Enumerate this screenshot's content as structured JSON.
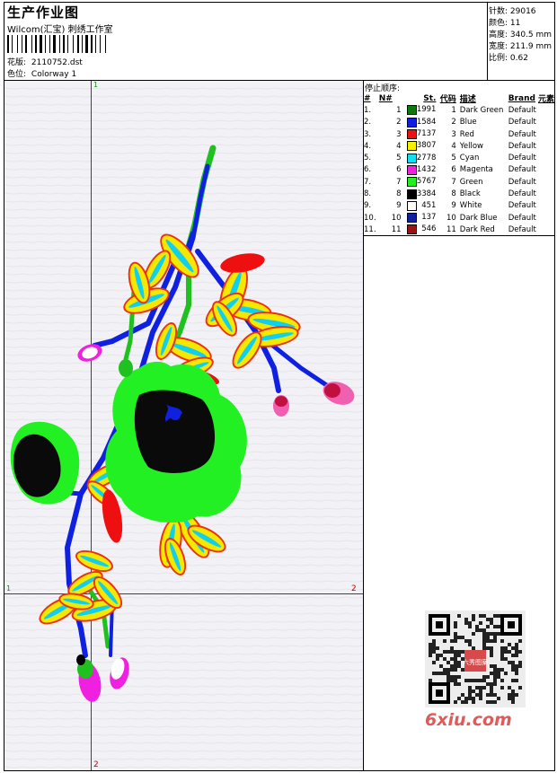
{
  "header": {
    "title": "生产作业图",
    "subtitle": "Wilcom(汇宝) 刺绣工作室",
    "design_label": "花版:",
    "design_value": "2110752.dst",
    "colorway_label": "色位:",
    "colorway_value": "Colorway 1"
  },
  "stats": {
    "stitches": "针数: 29016",
    "colors": "颜色: 11",
    "height": "高度: 340.5 mm",
    "width": "宽度: 211.9 mm",
    "scale": "比例: 0.62"
  },
  "guides": {
    "top_v": "1",
    "bottom_v": "2",
    "left_h": "1",
    "right_h": "2"
  },
  "stop_sequence": {
    "title": "停止顺序:",
    "headers": [
      "#",
      "N#",
      "St.",
      "代码",
      "描述",
      "Brand",
      "元素"
    ],
    "rows": [
      {
        "idx": "1.",
        "n": "1",
        "color": "#0a7a0a",
        "st": "1991",
        "code": "1",
        "desc": "Dark Green",
        "brand": "Default"
      },
      {
        "idx": "2.",
        "n": "2",
        "color": "#1020e0",
        "st": "1584",
        "code": "2",
        "desc": "Blue",
        "brand": "Default"
      },
      {
        "idx": "3.",
        "n": "3",
        "color": "#ee1010",
        "st": "7137",
        "code": "3",
        "desc": "Red",
        "brand": "Default"
      },
      {
        "idx": "4.",
        "n": "4",
        "color": "#f5f000",
        "st": "3807",
        "code": "4",
        "desc": "Yellow",
        "brand": "Default"
      },
      {
        "idx": "5.",
        "n": "5",
        "color": "#10e0f0",
        "st": "2778",
        "code": "5",
        "desc": "Cyan",
        "brand": "Default"
      },
      {
        "idx": "6.",
        "n": "6",
        "color": "#f020e0",
        "st": "1432",
        "code": "6",
        "desc": "Magenta",
        "brand": "Default"
      },
      {
        "idx": "7.",
        "n": "7",
        "color": "#20f020",
        "st": "5767",
        "code": "7",
        "desc": "Green",
        "brand": "Default"
      },
      {
        "idx": "8.",
        "n": "8",
        "color": "#000000",
        "st": "3384",
        "code": "8",
        "desc": "Black",
        "brand": "Default"
      },
      {
        "idx": "9.",
        "n": "9",
        "color": "#ffffff",
        "st": "451",
        "code": "9",
        "desc": "White",
        "brand": "Default"
      },
      {
        "idx": "10.",
        "n": "10",
        "color": "#1020a0",
        "st": "137",
        "code": "10",
        "desc": "Dark Blue",
        "brand": "Default"
      },
      {
        "idx": "11.",
        "n": "11",
        "color": "#a01010",
        "st": "546",
        "code": "11",
        "desc": "Dark Red",
        "brand": "Default"
      }
    ]
  },
  "watermark": {
    "site": "6xiu.com",
    "stamp": "六秀图案"
  },
  "colors": {
    "guide_red": "#e00000",
    "guide_label_green": "#00a000",
    "canvas_bg": "#f2f2f6"
  }
}
